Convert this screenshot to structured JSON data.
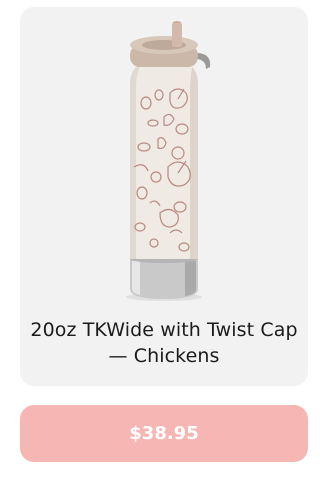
{
  "product": {
    "title": "20oz TKWide with Twist Cap — Chickens",
    "image_icon": "chicken-pattern-bottle",
    "bottle_color": "#efeae4",
    "pattern_color": "#b98a80",
    "cap_color": "#cbb8a8"
  },
  "price_button": {
    "label": "$38.95",
    "color": "#f6b6b4"
  }
}
